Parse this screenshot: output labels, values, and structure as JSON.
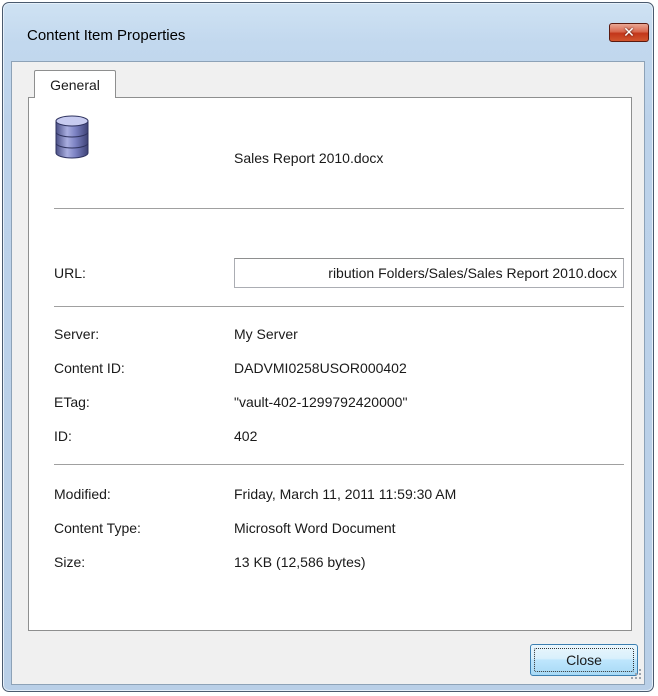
{
  "window": {
    "title": "Content Item Properties"
  },
  "tabs": [
    {
      "label": "General"
    }
  ],
  "item": {
    "name": "Sales Report 2010.docx",
    "icon": "database-icon"
  },
  "url": {
    "label": "URL:",
    "value": "ribution Folders/Sales/Sales Report 2010.docx"
  },
  "details": [
    {
      "label": "Server:",
      "value": "My Server"
    },
    {
      "label": "Content ID:",
      "value": "DADVMI0258USOR000402"
    },
    {
      "label": "ETag:",
      "value": "\"vault-402-1299792420000\""
    },
    {
      "label": "ID:",
      "value": "402"
    }
  ],
  "info": [
    {
      "label": "Modified:",
      "value": "Friday, March 11, 2011 11:59:30 AM"
    },
    {
      "label": "Content Type:",
      "value": "Microsoft Word Document"
    },
    {
      "label": "Size:",
      "value": "13 KB (12,586 bytes)"
    }
  ],
  "buttons": {
    "close": "Close",
    "titlebar_close_glyph": "✕"
  },
  "colors": {
    "close_button_red": "#c3361a",
    "accent_blue": "#3c7fb1"
  }
}
